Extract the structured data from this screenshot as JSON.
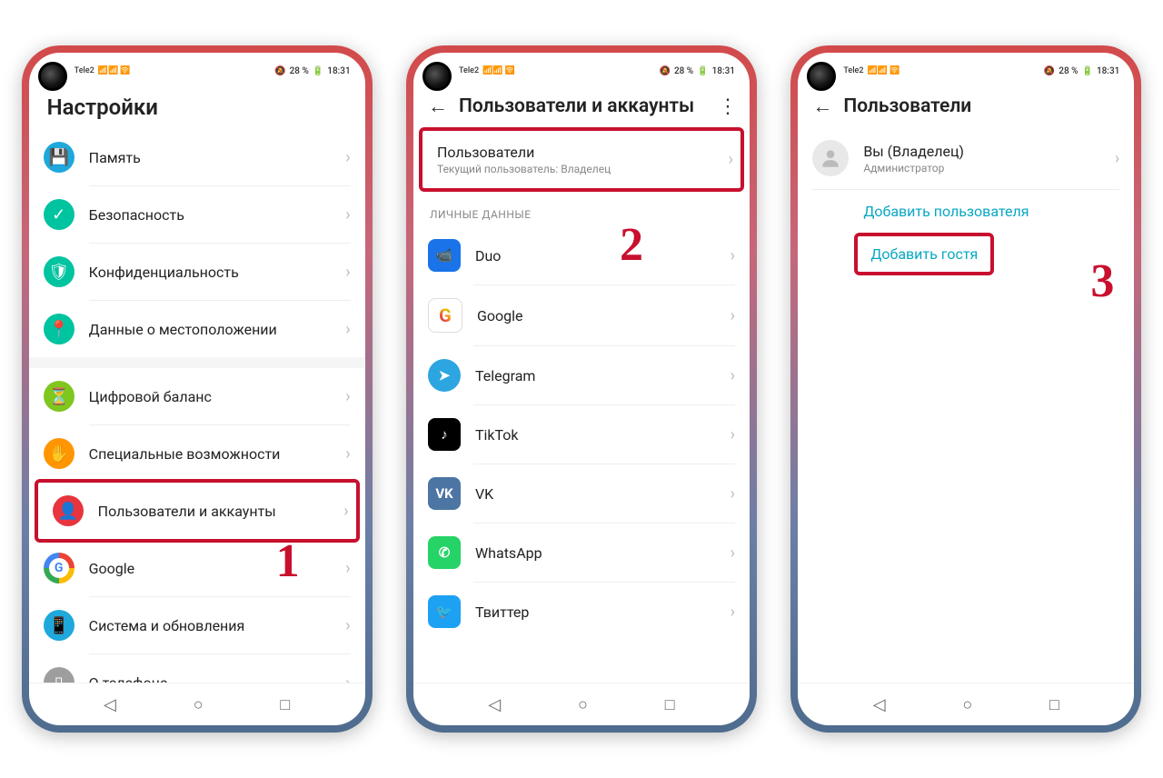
{
  "status": {
    "carrier": "Tele2",
    "signal": "📶",
    "battery_text": "28 %",
    "time": "18:31",
    "mute": "🔕"
  },
  "phone1": {
    "title": "Настройки",
    "items": [
      {
        "label": "Память",
        "icon": "💾",
        "color": "#1ea8db"
      },
      {
        "label": "Безопасность",
        "icon": "✓",
        "color": "#00c3a0"
      },
      {
        "label": "Конфиденциальность",
        "icon": "🛡",
        "color": "#00c3a0"
      },
      {
        "label": "Данные о местоположении",
        "icon": "📍",
        "color": "#00c3a0"
      },
      {
        "label": "Цифровой баланс",
        "icon": "⏳",
        "color": "#7fc71f"
      },
      {
        "label": "Специальные возможности",
        "icon": "✋",
        "color": "#ff9500"
      },
      {
        "label": "Пользователи и аккаунты",
        "icon": "👤",
        "color": "#e8343e",
        "hl": true
      },
      {
        "label": "Google",
        "icon": "G",
        "color": "#fff",
        "google": true
      },
      {
        "label": "Система и обновления",
        "icon": "📱",
        "color": "#1ea8db"
      },
      {
        "label": "О телефоне",
        "icon": "▯",
        "color": "#9e9e9e"
      }
    ],
    "step": "1"
  },
  "phone2": {
    "title": "Пользователи и аккаунты",
    "users_row": {
      "label": "Пользователи",
      "sub": "Текущий пользователь: Владелец"
    },
    "section": "ЛИЧНЫЕ ДАННЫЕ",
    "apps": [
      {
        "label": "Duo",
        "bg": "#1a73e8",
        "txt": "📹"
      },
      {
        "label": "Google",
        "bg": "#fff",
        "txt": "G",
        "google": true
      },
      {
        "label": "Telegram",
        "bg": "#2ca5e0",
        "txt": "➤",
        "round": true
      },
      {
        "label": "TikTok",
        "bg": "#000",
        "txt": "♪"
      },
      {
        "label": "VK",
        "bg": "#4c75a3",
        "txt": "VK"
      },
      {
        "label": "WhatsApp",
        "bg": "#25d366",
        "txt": "✆"
      },
      {
        "label": "Твиттер",
        "bg": "#1da1f2",
        "txt": "🐦"
      }
    ],
    "step": "2"
  },
  "phone3": {
    "title": "Пользователи",
    "owner": {
      "label": "Вы (Владелец)",
      "sub": "Администратор"
    },
    "add_user": "Добавить пользователя",
    "add_guest": "Добавить гостя",
    "step": "3"
  },
  "nav": {
    "back": "◁",
    "home": "○",
    "recent": "□"
  }
}
